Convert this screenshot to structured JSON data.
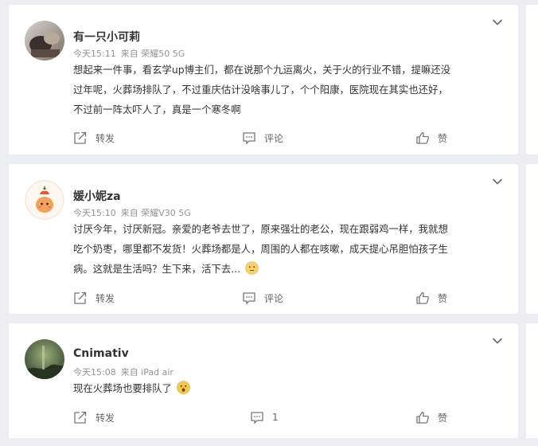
{
  "posts": [
    {
      "username": "有一只小可莉",
      "time": "今天15:11",
      "source": "来自 荣耀50 5G",
      "lines": [
        "想起来一件事，看玄学up博主们，都在说那个九运离火，关于火的行业不错，提嘛还没",
        "过年呢，火葬场排队了，不过重庆估计没啥事儿了，个个阳康，医院现在其实也还好，",
        "不过前一阵太吓人了，真是一个寒冬啊"
      ],
      "actions": {
        "repost": "转发",
        "comment": "评论",
        "like": "赞"
      }
    },
    {
      "username": "媛小妮za",
      "time": "今天15:10",
      "source": "来自 荣耀V30 5G",
      "lines": [
        "讨厌今年，讨厌新冠。亲爱的老爷去世了，原来强壮的老公，现在跟弱鸡一样，我就想",
        "吃个奶枣，哪里都不发货！火葬场都是人，周围的人都在咳嗽，成天提心吊胆怕孩子生",
        "病。这就是生活吗？生下来，活下去..."
      ],
      "actions": {
        "repost": "转发",
        "comment": "评论",
        "like": "赞"
      }
    },
    {
      "username": "Cnimativ",
      "time": "今天15:08",
      "source": "来自 iPad air",
      "lines": [
        "现在火葬场也要排队了"
      ],
      "actions": {
        "repost": "转发",
        "comment": "1",
        "like": "赞"
      }
    }
  ],
  "icons": {
    "chevron": "chevron-down-icon",
    "repost": "repost-icon",
    "comment": "comment-icon",
    "like": "thumbs-up-icon",
    "emoji_2": "speechless-face-emoji",
    "emoji_3": "surprised-face-emoji"
  },
  "colors": {
    "page_background": "#eceef1",
    "card_background": "#ffffff",
    "text": "#333333",
    "meta_text": "#939393",
    "action_text": "#666666"
  }
}
